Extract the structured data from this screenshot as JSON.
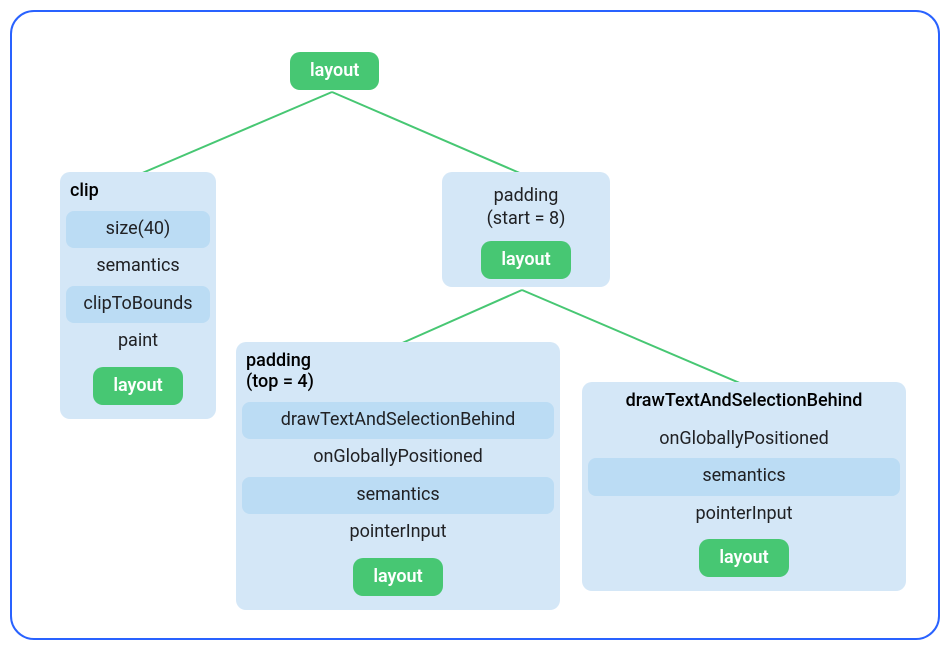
{
  "root": {
    "label": "layout"
  },
  "clip": {
    "head": "clip",
    "levels": [
      "size(40)",
      "semantics",
      "clipToBounds",
      "paint"
    ],
    "leaf": "layout"
  },
  "padding": {
    "head_line1": "padding",
    "head_line2": "(start = 8)",
    "leaf": "layout"
  },
  "leftLeaf": {
    "head_line1": "padding",
    "head_line2": "(top = 4)",
    "levels": [
      "drawTextAndSelectionBehind",
      "onGloballyPositioned",
      "semantics",
      "pointerInput"
    ],
    "leaf": "layout"
  },
  "rightLeaf": {
    "head": "drawTextAndSelectionBehind",
    "levels": [
      "onGloballyPositioned",
      "semantics",
      "pointerInput"
    ],
    "leaf": "layout"
  }
}
